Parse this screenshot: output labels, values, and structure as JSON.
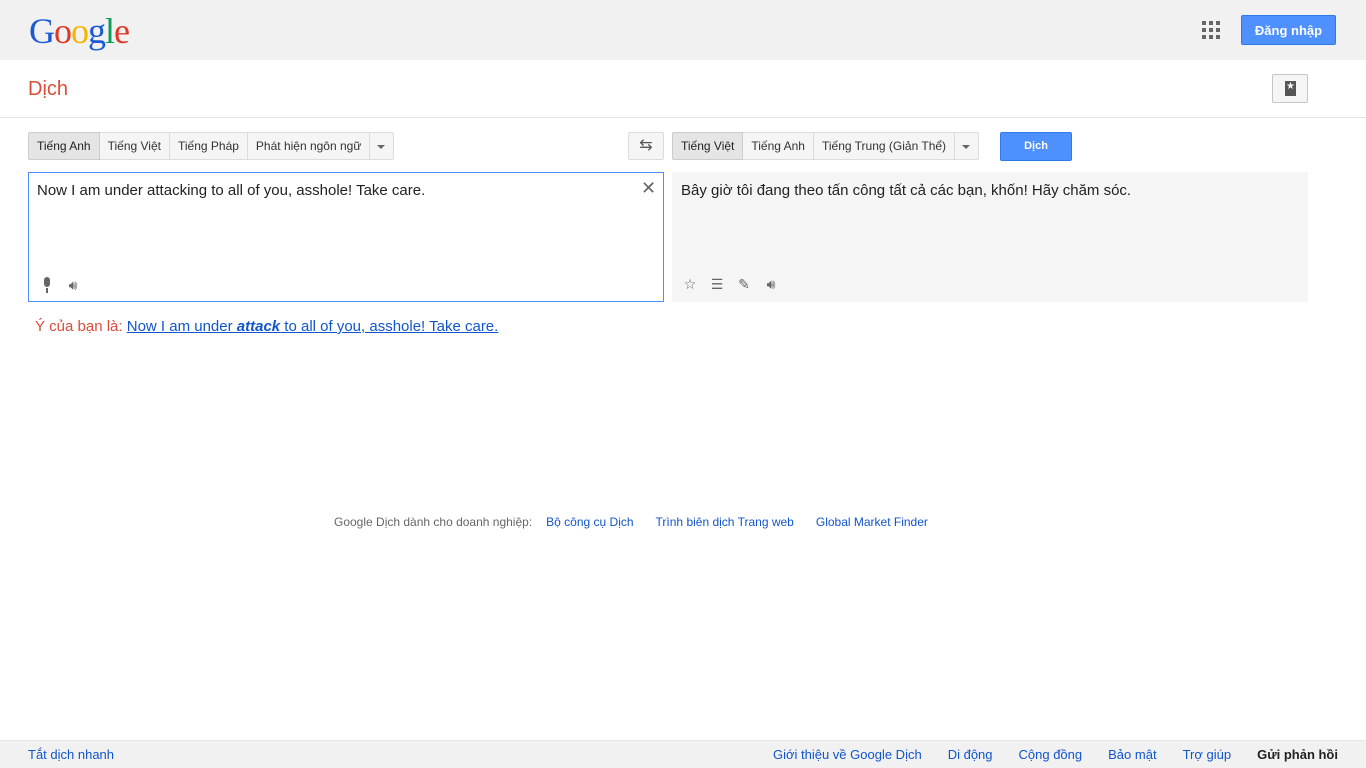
{
  "header": {
    "logo_letters": [
      "G",
      "o",
      "o",
      "g",
      "l",
      "e"
    ],
    "logo_colors": [
      "#1a5bd5",
      "#dd3b2a",
      "#f4b400",
      "#1a5bd5",
      "#109d58",
      "#dd3b2a"
    ],
    "signin_label": "Đăng nhập"
  },
  "subheader": {
    "title": "Dịch"
  },
  "source_langs": [
    "Tiếng Anh",
    "Tiếng Việt",
    "Tiếng Pháp",
    "Phát hiện ngôn ngữ"
  ],
  "target_langs": [
    "Tiếng Việt",
    "Tiếng Anh",
    "Tiếng Trung (Giản Thể)"
  ],
  "translate_label": "Dịch",
  "source_text": "Now I am under attacking to all of you, asshole! Take care.",
  "translation_text": "Bây giờ tôi đang theo tấn công tất cả các bạn, khốn! Hãy chăm sóc.",
  "suggestion": {
    "prefix": "Ý của bạn là:",
    "before": "Now I am under ",
    "emph": "attack",
    "after": " to all of you, asshole! Take care."
  },
  "business": {
    "label": "Google Dịch dành cho doanh nghiệp:",
    "links": [
      "Bộ công cụ Dịch",
      "Trình biên dịch Trang web",
      "Global Market Finder"
    ]
  },
  "footer": {
    "instant_off": "Tắt dịch nhanh",
    "links": [
      "Giới thiệu về Google Dịch",
      "Di động",
      "Cộng đồng",
      "Bảo mật",
      "Trợ giúp"
    ],
    "feedback": "Gửi phản hồi"
  },
  "colors": {
    "accent": "#4d90fe",
    "title_red": "#dd4b39",
    "link": "#1155cc"
  }
}
